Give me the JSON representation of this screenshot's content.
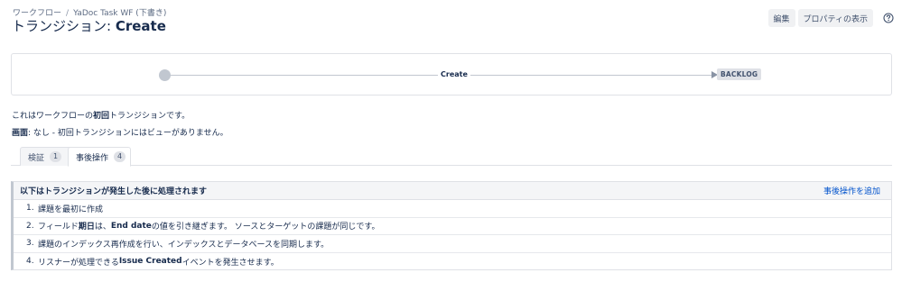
{
  "breadcrumb": {
    "items": [
      "ワークフロー",
      "YaDoc Task WF (下書き)"
    ],
    "separator": "/"
  },
  "title": {
    "prefix": "トランジション:",
    "name": "Create"
  },
  "actions": {
    "edit_label": "編集",
    "properties_label": "プロパティの表示",
    "help_icon": "help-icon"
  },
  "diagram": {
    "transition_label": "Create",
    "target_status": "BACKLOG"
  },
  "description": {
    "line1_before": "これはワークフローの",
    "line1_bold": "初回",
    "line1_after": "トランジションです。",
    "line2_bold": "画面",
    "line2_rest": ": なし - 初回トランジションにはビューがありません。"
  },
  "tabs": [
    {
      "label": "検証",
      "count": "1"
    },
    {
      "label": "事後操作",
      "count": "4"
    }
  ],
  "post_functions": {
    "header": "以下はトランジションが発生した後に処理されます",
    "add_link": "事後操作を追加",
    "items": [
      {
        "num": "1.",
        "segments": [
          "課題を最初に作成"
        ]
      },
      {
        "num": "2.",
        "segments": [
          "フィールド",
          "期日",
          "は、",
          "End date",
          "の値を引き継ぎます。 ソースとターゲットの課題が同じです。"
        ]
      },
      {
        "num": "3.",
        "segments": [
          "課題のインデックス再作成を行い、インデックスとデータベースを同期します。"
        ]
      },
      {
        "num": "4.",
        "segments": [
          "リスナーが処理できる ",
          "Issue Created",
          " イベントを発生させます。"
        ]
      }
    ]
  }
}
